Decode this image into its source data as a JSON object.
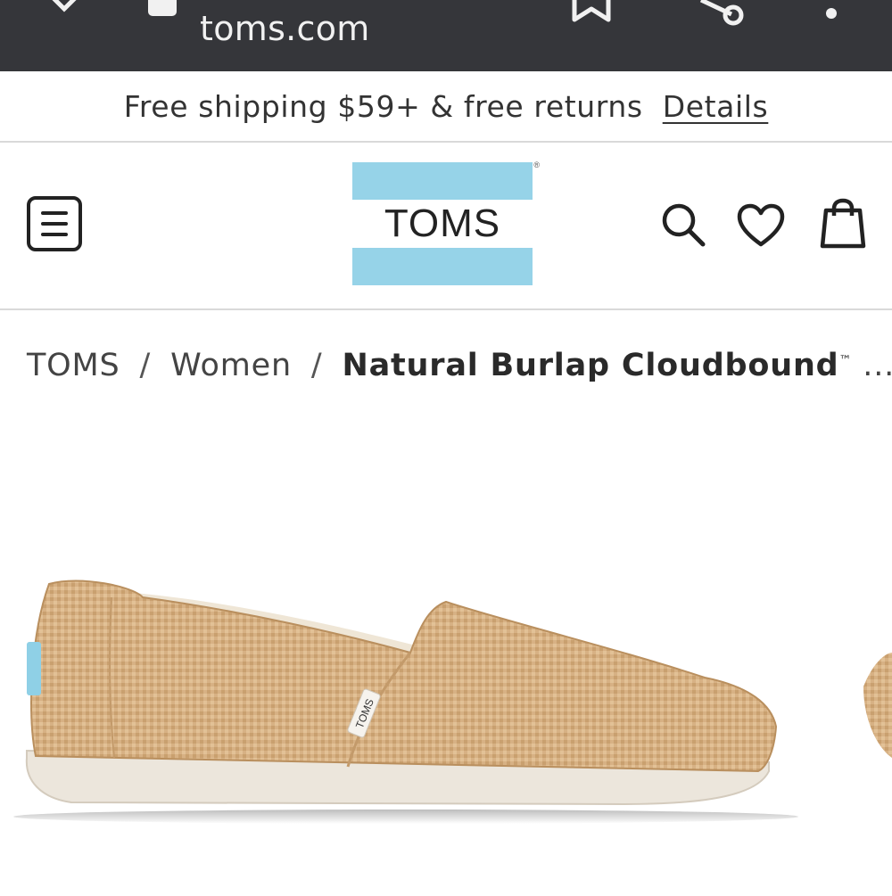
{
  "browser": {
    "url": "toms.com",
    "icons": [
      "close-icon",
      "tab-icon",
      "bookmark-icon",
      "share-icon",
      "more-options-icon"
    ]
  },
  "promo": {
    "text": "Free shipping $59+ & free returns",
    "link_label": "Details"
  },
  "header": {
    "logo_text": "TOMS",
    "logo_mark": "®",
    "icons": [
      "menu-icon",
      "search-icon",
      "heart-icon",
      "bag-icon"
    ],
    "colors": {
      "logo_stripe": "#96d3e8"
    }
  },
  "breadcrumb": {
    "items": [
      "TOMS",
      "Women"
    ],
    "separator": "/",
    "current": "Natural Burlap Cloudbound",
    "current_mark": "™",
    "ellipsis": "..."
  },
  "product": {
    "image": "shoe-image",
    "tag_text": "TOMS"
  }
}
